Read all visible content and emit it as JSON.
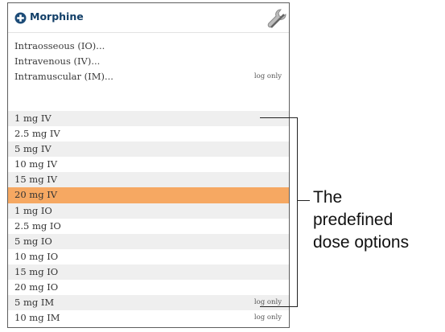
{
  "header": {
    "title": "Morphine"
  },
  "routes": [
    {
      "label": "Intraosseous (IO)...",
      "tag": ""
    },
    {
      "label": "Intravenous (IV)...",
      "tag": ""
    },
    {
      "label": "Intramuscular (IM)...",
      "tag": "log only"
    }
  ],
  "doses": [
    {
      "label": "1 mg IV",
      "tag": ""
    },
    {
      "label": "2.5 mg IV",
      "tag": ""
    },
    {
      "label": "5 mg IV",
      "tag": ""
    },
    {
      "label": "10 mg IV",
      "tag": ""
    },
    {
      "label": "15 mg IV",
      "tag": ""
    },
    {
      "label": "20 mg IV",
      "tag": "",
      "selected": true
    },
    {
      "label": "1 mg IO",
      "tag": ""
    },
    {
      "label": "2.5 mg IO",
      "tag": ""
    },
    {
      "label": "5 mg IO",
      "tag": ""
    },
    {
      "label": "10 mg IO",
      "tag": ""
    },
    {
      "label": "15 mg IO",
      "tag": ""
    },
    {
      "label": "20 mg IO",
      "tag": ""
    },
    {
      "label": "5 mg IM",
      "tag": "log only"
    },
    {
      "label": "10 mg IM",
      "tag": "log only"
    }
  ],
  "annotation": {
    "line1": "The",
    "line2": "predefined",
    "line3": "dose options"
  },
  "colors": {
    "selected": "#f6a862",
    "title": "#123f68",
    "stripe": "#efefef"
  },
  "icons": {
    "add": "plus-circle-icon",
    "settings": "wrench-icon"
  }
}
